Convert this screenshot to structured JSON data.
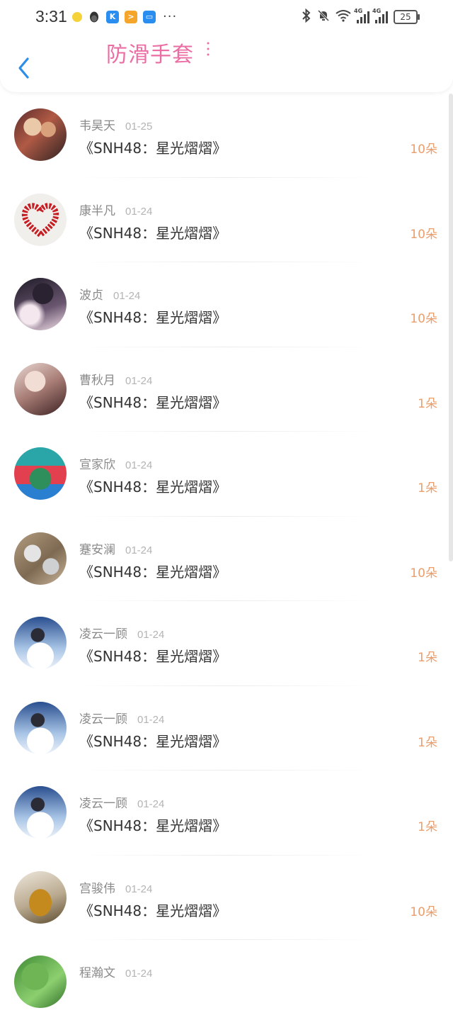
{
  "status_bar": {
    "time": "3:31",
    "battery": "25",
    "network_1": "4G",
    "network_2": "4G",
    "dots": "···"
  },
  "header": {
    "title": "防滑手套"
  },
  "list": {
    "items": [
      {
        "name": "韦昊天",
        "date": "01-25",
        "gift": "《SNH48：星光熠熠》",
        "count": "10朵"
      },
      {
        "name": "康半凡",
        "date": "01-24",
        "gift": "《SNH48：星光熠熠》",
        "count": "10朵"
      },
      {
        "name": "波贞",
        "date": "01-24",
        "gift": "《SNH48：星光熠熠》",
        "count": "10朵"
      },
      {
        "name": "曹秋月",
        "date": "01-24",
        "gift": "《SNH48：星光熠熠》",
        "count": "1朵"
      },
      {
        "name": "宣家欣",
        "date": "01-24",
        "gift": "《SNH48：星光熠熠》",
        "count": "1朵"
      },
      {
        "name": "蹇安澜",
        "date": "01-24",
        "gift": "《SNH48：星光熠熠》",
        "count": "10朵"
      },
      {
        "name": "凌云一顾",
        "date": "01-24",
        "gift": "《SNH48：星光熠熠》",
        "count": "1朵"
      },
      {
        "name": "凌云一顾",
        "date": "01-24",
        "gift": "《SNH48：星光熠熠》",
        "count": "1朵"
      },
      {
        "name": "凌云一顾",
        "date": "01-24",
        "gift": "《SNH48：星光熠熠》",
        "count": "1朵"
      },
      {
        "name": "宫骏伟",
        "date": "01-24",
        "gift": "《SNH48：星光熠熠》",
        "count": "10朵"
      },
      {
        "name": "程瀚文",
        "date": "01-24",
        "gift": "",
        "count": ""
      }
    ]
  },
  "colors": {
    "title": "#ea6da3",
    "count": "#e89e6d",
    "back_arrow": "#2d8ee8"
  },
  "icons": {
    "back": "chevron-left-icon",
    "status_apps": [
      "app-icon-yellow",
      "qq-penguin-icon",
      "k-app-icon",
      "play-app-icon",
      "tv-app-icon"
    ],
    "status_right": [
      "bluetooth-icon",
      "mute-bell-icon",
      "wifi-icon",
      "signal-icon",
      "battery-icon"
    ]
  }
}
